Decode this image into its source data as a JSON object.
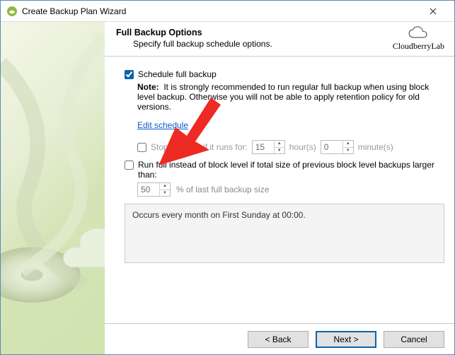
{
  "window": {
    "title": "Create Backup Plan Wizard"
  },
  "header": {
    "title": "Full Backup Options",
    "subtitle": "Specify full backup schedule options."
  },
  "brand": {
    "label": "CloudberryLab"
  },
  "options": {
    "schedule_label": "Schedule full backup",
    "schedule_checked": true,
    "note_label": "Note:",
    "note_text": "It is strongly recommended to run regular full backup when using block level backup. Otherwise you will not be able to apply retention policy for old versions.",
    "edit_link": "Edit schedule",
    "stop_label": "Stop the plan if it runs for:",
    "stop_checked": false,
    "stop_hours": "15",
    "stop_hours_unit": "hour(s)",
    "stop_minutes": "0",
    "stop_minutes_unit": "minute(s)",
    "runfull_label": "Run full instead of block level if total size of previous block level backups larger than:",
    "runfull_checked": false,
    "runfull_percent": "50",
    "runfull_percent_unit": "% of last full backup size",
    "occurs_text": "Occurs every month on First Sunday at 00:00."
  },
  "footer": {
    "back": "< Back",
    "next": "Next >",
    "cancel": "Cancel"
  }
}
